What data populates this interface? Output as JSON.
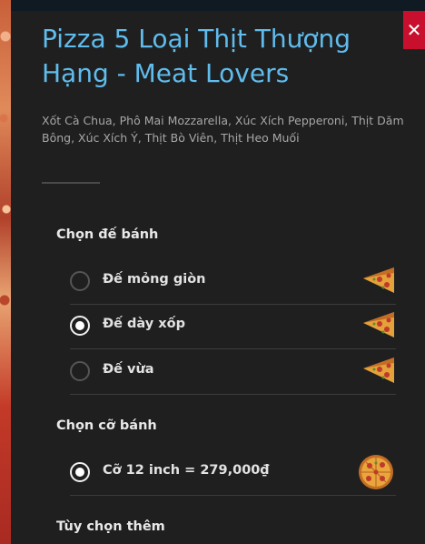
{
  "product": {
    "title": "Pizza 5 Loại Thịt Thượng Hạng - Meat Lovers",
    "description": "Xốt Cà Chua, Phô Mai Mozzarella, Xúc Xích Pepperoni, Thịt Dăm Bông, Xúc Xích Ý, Thịt Bò Viên, Thịt Heo Muối"
  },
  "close_icon": "✕",
  "crust": {
    "label": "Chọn đế bánh",
    "options": [
      {
        "label": "Đế mỏng giòn",
        "selected": false,
        "icon": "pizza-slice-icon"
      },
      {
        "label": "Đế dày xốp",
        "selected": true,
        "icon": "pizza-slice-icon"
      },
      {
        "label": "Đế vừa",
        "selected": false,
        "icon": "pizza-slice-icon"
      }
    ]
  },
  "size": {
    "label": "Chọn cỡ bánh",
    "options": [
      {
        "label": "Cỡ 12 inch =  279,000₫",
        "selected": true,
        "icon": "whole-pizza-icon"
      }
    ]
  },
  "extras": {
    "label": "Tùy chọn thêm"
  },
  "colors": {
    "title": "#5fbcec",
    "close_bg": "#c8102e",
    "panel_bg": "#1f1f20"
  }
}
